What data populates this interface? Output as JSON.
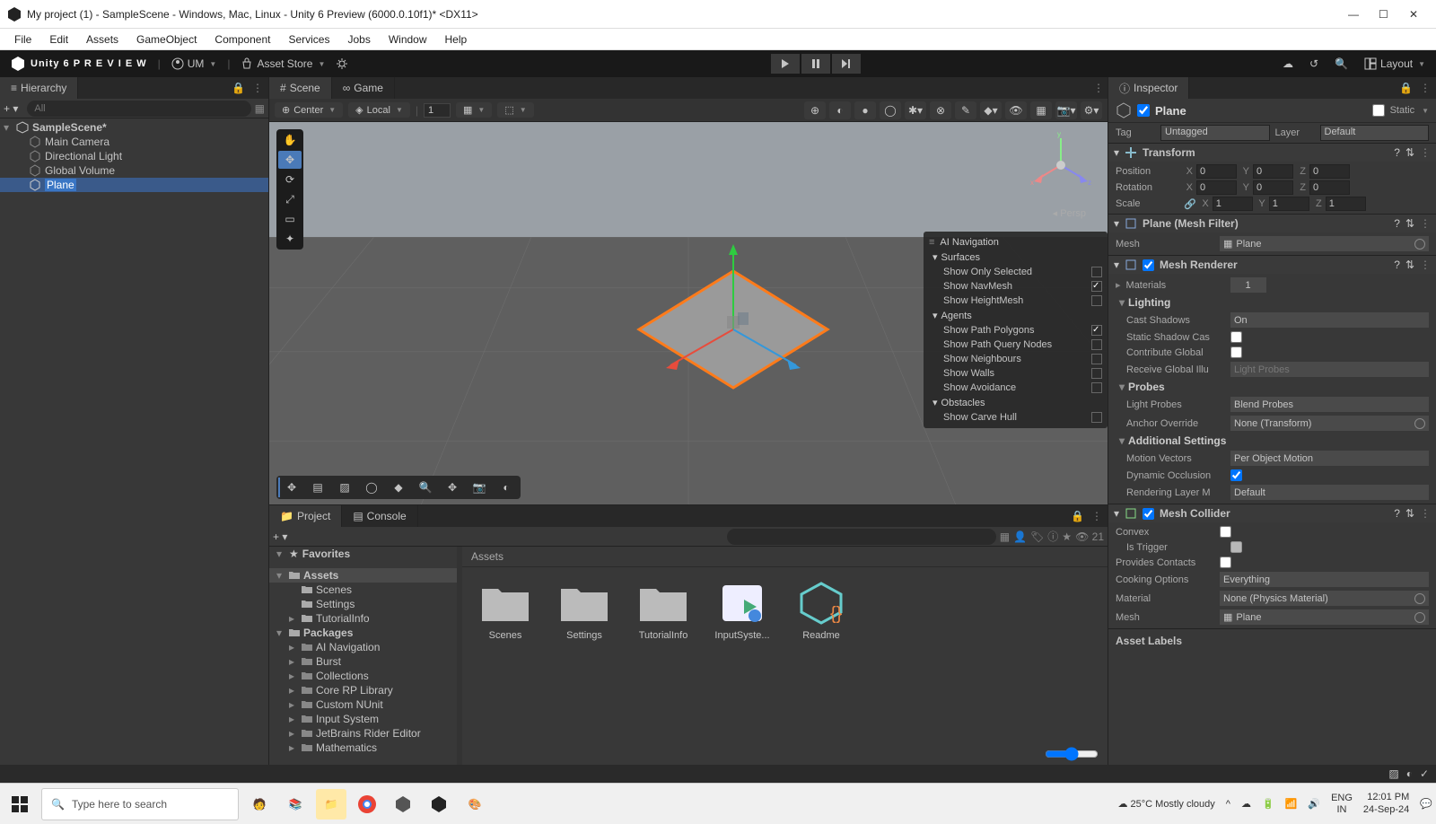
{
  "window": {
    "title": "My project (1) - SampleScene - Windows, Mac, Linux - Unity 6 Preview (6000.0.10f1)* <DX11>"
  },
  "menus": [
    "File",
    "Edit",
    "Assets",
    "GameObject",
    "Component",
    "Services",
    "Jobs",
    "Window",
    "Help"
  ],
  "topbar": {
    "brand": "Unity 6 P R E V I E W",
    "account": "UM",
    "asset_store": "Asset Store",
    "layout": "Layout"
  },
  "hierarchy": {
    "tab": "Hierarchy",
    "search_placeholder": "All",
    "scene": "SampleScene*",
    "items": [
      "Main Camera",
      "Directional Light",
      "Global Volume",
      "Plane"
    ],
    "selected": "Plane"
  },
  "scene": {
    "tab_scene": "Scene",
    "tab_game": "Game",
    "pivot": "Center",
    "space": "Local",
    "grid_value": "1",
    "persp": "Persp",
    "overlay": {
      "title": "AI Navigation",
      "group1": "Surfaces",
      "items1": [
        {
          "label": "Show Only Selected",
          "checked": false
        },
        {
          "label": "Show NavMesh",
          "checked": true
        },
        {
          "label": "Show HeightMesh",
          "checked": false
        }
      ],
      "group2": "Agents",
      "items2": [
        {
          "label": "Show Path Polygons",
          "checked": true
        },
        {
          "label": "Show Path Query Nodes",
          "checked": false
        },
        {
          "label": "Show Neighbours",
          "checked": false
        },
        {
          "label": "Show Walls",
          "checked": false
        },
        {
          "label": "Show Avoidance",
          "checked": false
        }
      ],
      "group3": "Obstacles",
      "items3": [
        {
          "label": "Show Carve Hull",
          "checked": false
        }
      ]
    }
  },
  "inspector": {
    "tab": "Inspector",
    "name": "Plane",
    "static": "Static",
    "tag_label": "Tag",
    "tag": "Untagged",
    "layer_label": "Layer",
    "layer": "Default",
    "transform": {
      "title": "Transform",
      "position": {
        "label": "Position",
        "x": "0",
        "y": "0",
        "z": "0"
      },
      "rotation": {
        "label": "Rotation",
        "x": "0",
        "y": "0",
        "z": "0"
      },
      "scale": {
        "label": "Scale",
        "x": "1",
        "y": "1",
        "z": "1"
      }
    },
    "mesh_filter": {
      "title": "Plane (Mesh Filter)",
      "mesh_label": "Mesh",
      "mesh": "Plane"
    },
    "mesh_renderer": {
      "title": "Mesh Renderer",
      "materials": {
        "label": "Materials",
        "count": "1"
      },
      "lighting": "Lighting",
      "cast_shadows": {
        "label": "Cast Shadows",
        "value": "On"
      },
      "static_shadow": {
        "label": "Static Shadow Cas"
      },
      "contribute_gi": {
        "label": "Contribute Global"
      },
      "receive_gi": {
        "label": "Receive Global Illu",
        "value": "Light Probes"
      },
      "probes": "Probes",
      "light_probes": {
        "label": "Light Probes",
        "value": "Blend Probes"
      },
      "anchor": {
        "label": "Anchor Override",
        "value": "None (Transform)"
      },
      "additional": "Additional Settings",
      "motion": {
        "label": "Motion Vectors",
        "value": "Per Object Motion"
      },
      "dynamic_occlusion": {
        "label": "Dynamic Occlusion"
      },
      "rendering_layer": {
        "label": "Rendering Layer M",
        "value": "Default"
      }
    },
    "mesh_collider": {
      "title": "Mesh Collider",
      "convex": "Convex",
      "is_trigger": "Is Trigger",
      "provides": "Provides Contacts",
      "cooking": {
        "label": "Cooking Options",
        "value": "Everything"
      },
      "material": {
        "label": "Material",
        "value": "None (Physics Material)"
      },
      "mesh": {
        "label": "Mesh",
        "value": "Plane"
      }
    },
    "asset_labels": "Asset Labels"
  },
  "project": {
    "tab_project": "Project",
    "tab_console": "Console",
    "count": "21",
    "favorites": "Favorites",
    "assets": "Assets",
    "assets_children": [
      "Scenes",
      "Settings",
      "TutorialInfo"
    ],
    "packages": "Packages",
    "packages_children": [
      "AI Navigation",
      "Burst",
      "Collections",
      "Core RP Library",
      "Custom NUnit",
      "Input System",
      "JetBrains Rider Editor",
      "Mathematics"
    ],
    "path": "Assets",
    "grid_items": [
      "Scenes",
      "Settings",
      "TutorialInfo",
      "InputSyste...",
      "Readme"
    ]
  },
  "taskbar": {
    "search": "Type here to search",
    "weather": "25°C  Mostly cloudy",
    "lang1": "ENG",
    "lang2": "IN",
    "time": "12:01 PM",
    "date": "24-Sep-24"
  }
}
